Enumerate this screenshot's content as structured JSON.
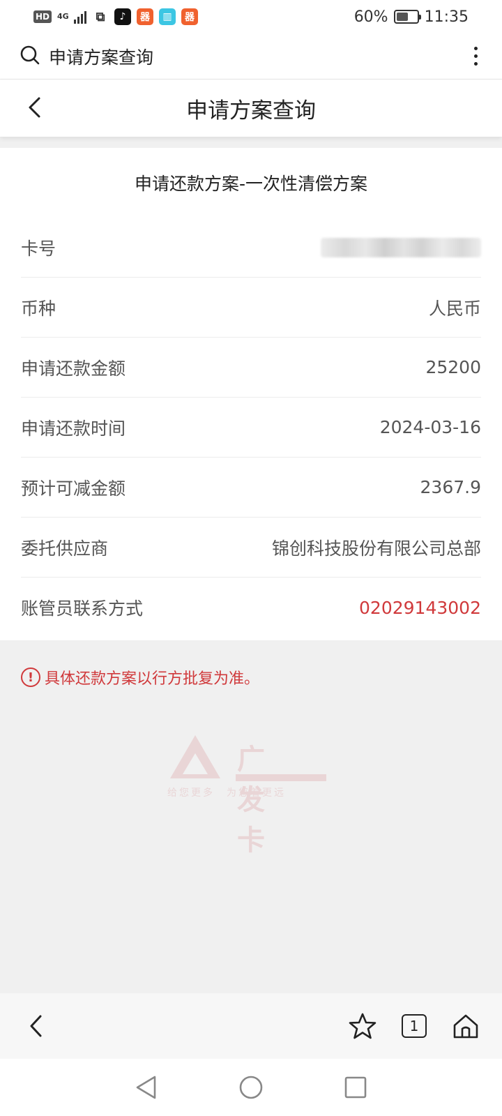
{
  "status_bar": {
    "hd_badge": "HD",
    "network": "4G",
    "battery_percent": "60%",
    "battery_level": 0.6,
    "time": "11:35",
    "app_icons": [
      "link-app-icon",
      "tiktok-icon",
      "orange-app-icon",
      "reader-app-icon",
      "orange-app-icon"
    ]
  },
  "browser": {
    "search_text": "申请方案查询",
    "tab_count": "1"
  },
  "header": {
    "title": "申请方案查询"
  },
  "plan": {
    "title": "申请还款方案-一次性清偿方案",
    "rows": [
      {
        "label": "卡号",
        "value": "",
        "masked": true
      },
      {
        "label": "币种",
        "value": "人民币"
      },
      {
        "label": "申请还款金额",
        "value": "25200"
      },
      {
        "label": "申请还款时间",
        "value": "2024-03-16"
      },
      {
        "label": "预计可减金额",
        "value": "2367.9"
      },
      {
        "label": "委托供应商",
        "value": "锦创科技股份有限公司总部"
      },
      {
        "label": "账管员联系方式",
        "value": "02029143002",
        "highlight": true
      }
    ]
  },
  "notice": {
    "text": "具体还款方案以行方批复为准。"
  },
  "watermark": {
    "name": "广发卡",
    "slogan": "给您更多　为您着更远"
  },
  "colors": {
    "accent_red": "#d0393b",
    "page_bg": "#f0f0f0"
  }
}
